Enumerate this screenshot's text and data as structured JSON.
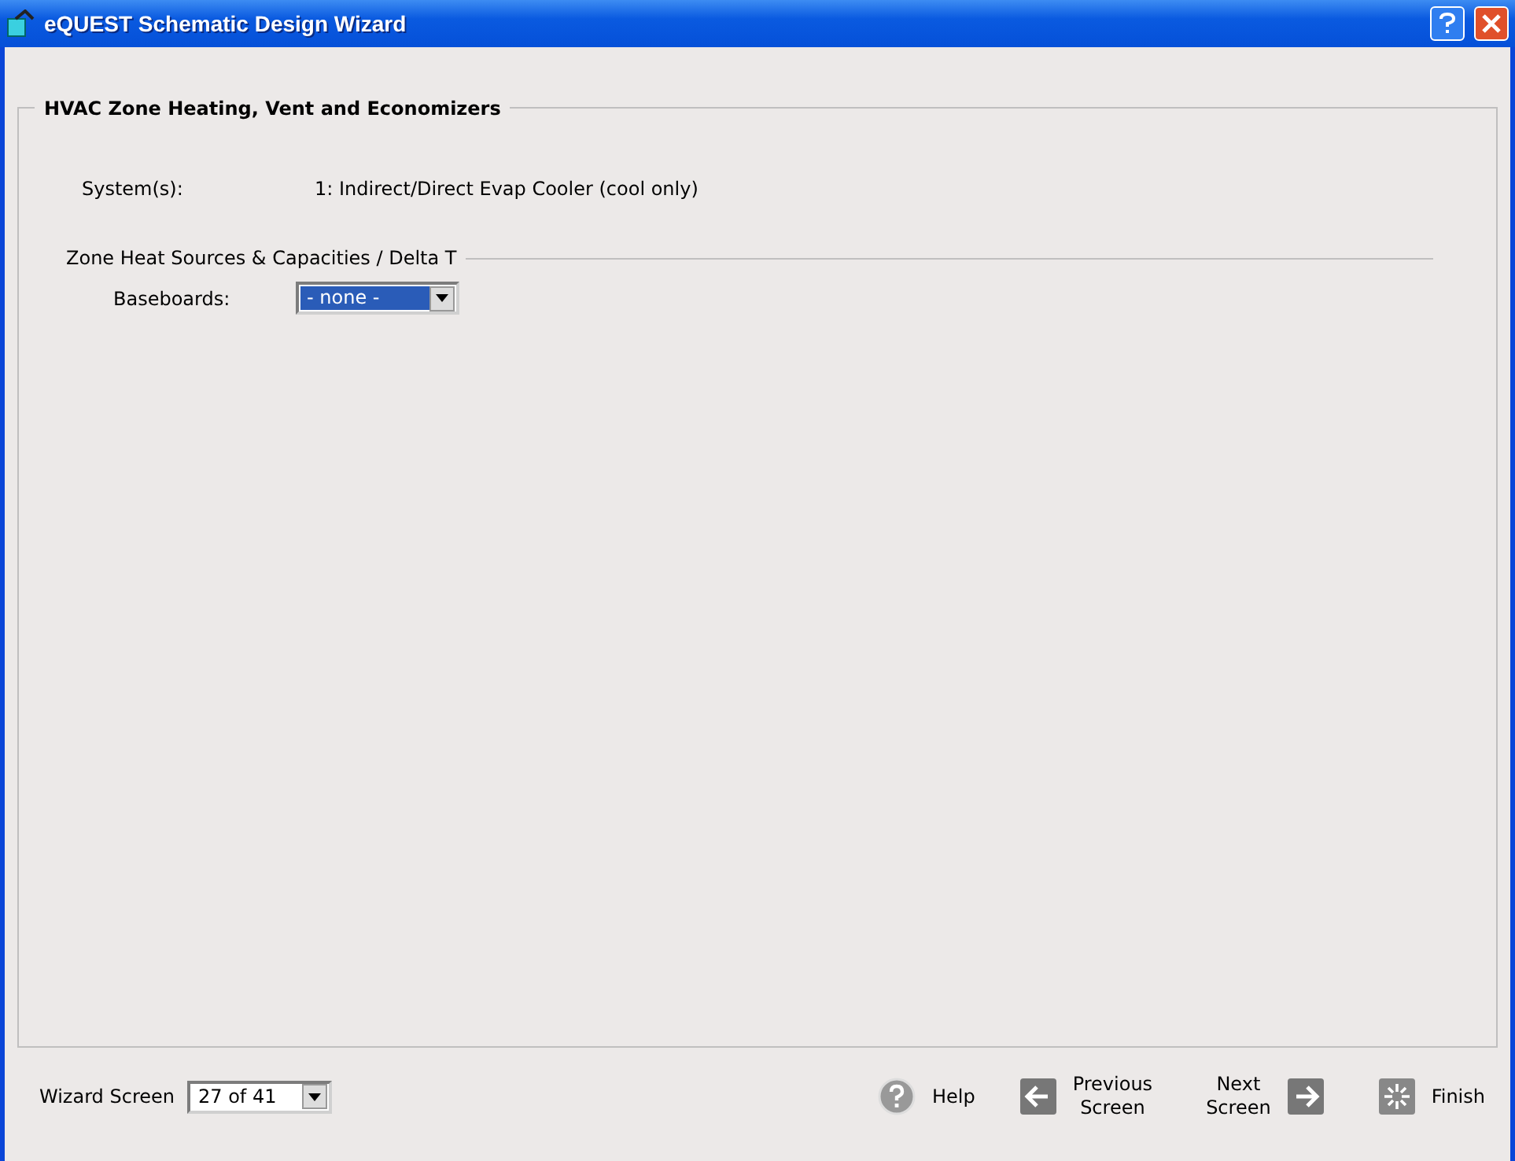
{
  "window": {
    "title": "eQUEST Schematic Design Wizard"
  },
  "panel": {
    "title": "HVAC Zone Heating, Vent and Economizers",
    "system": {
      "label": "System(s):",
      "value": "1: Indirect/Direct Evap Cooler (cool only)"
    },
    "section": {
      "title": "Zone Heat Sources & Capacities / Delta T",
      "fields": [
        {
          "label": "Baseboards:",
          "value": "- none -",
          "focused": true
        }
      ]
    }
  },
  "footer": {
    "screen_label": "Wizard Screen",
    "screen_value": "27 of 41",
    "buttons": [
      {
        "kind": "help",
        "lines": [
          "Help"
        ]
      },
      {
        "kind": "previous",
        "lines": [
          "Previous",
          "Screen"
        ]
      },
      {
        "kind": "next",
        "lines": [
          "Next",
          "Screen"
        ]
      },
      {
        "kind": "finish",
        "lines": [
          "Finish"
        ]
      }
    ]
  }
}
